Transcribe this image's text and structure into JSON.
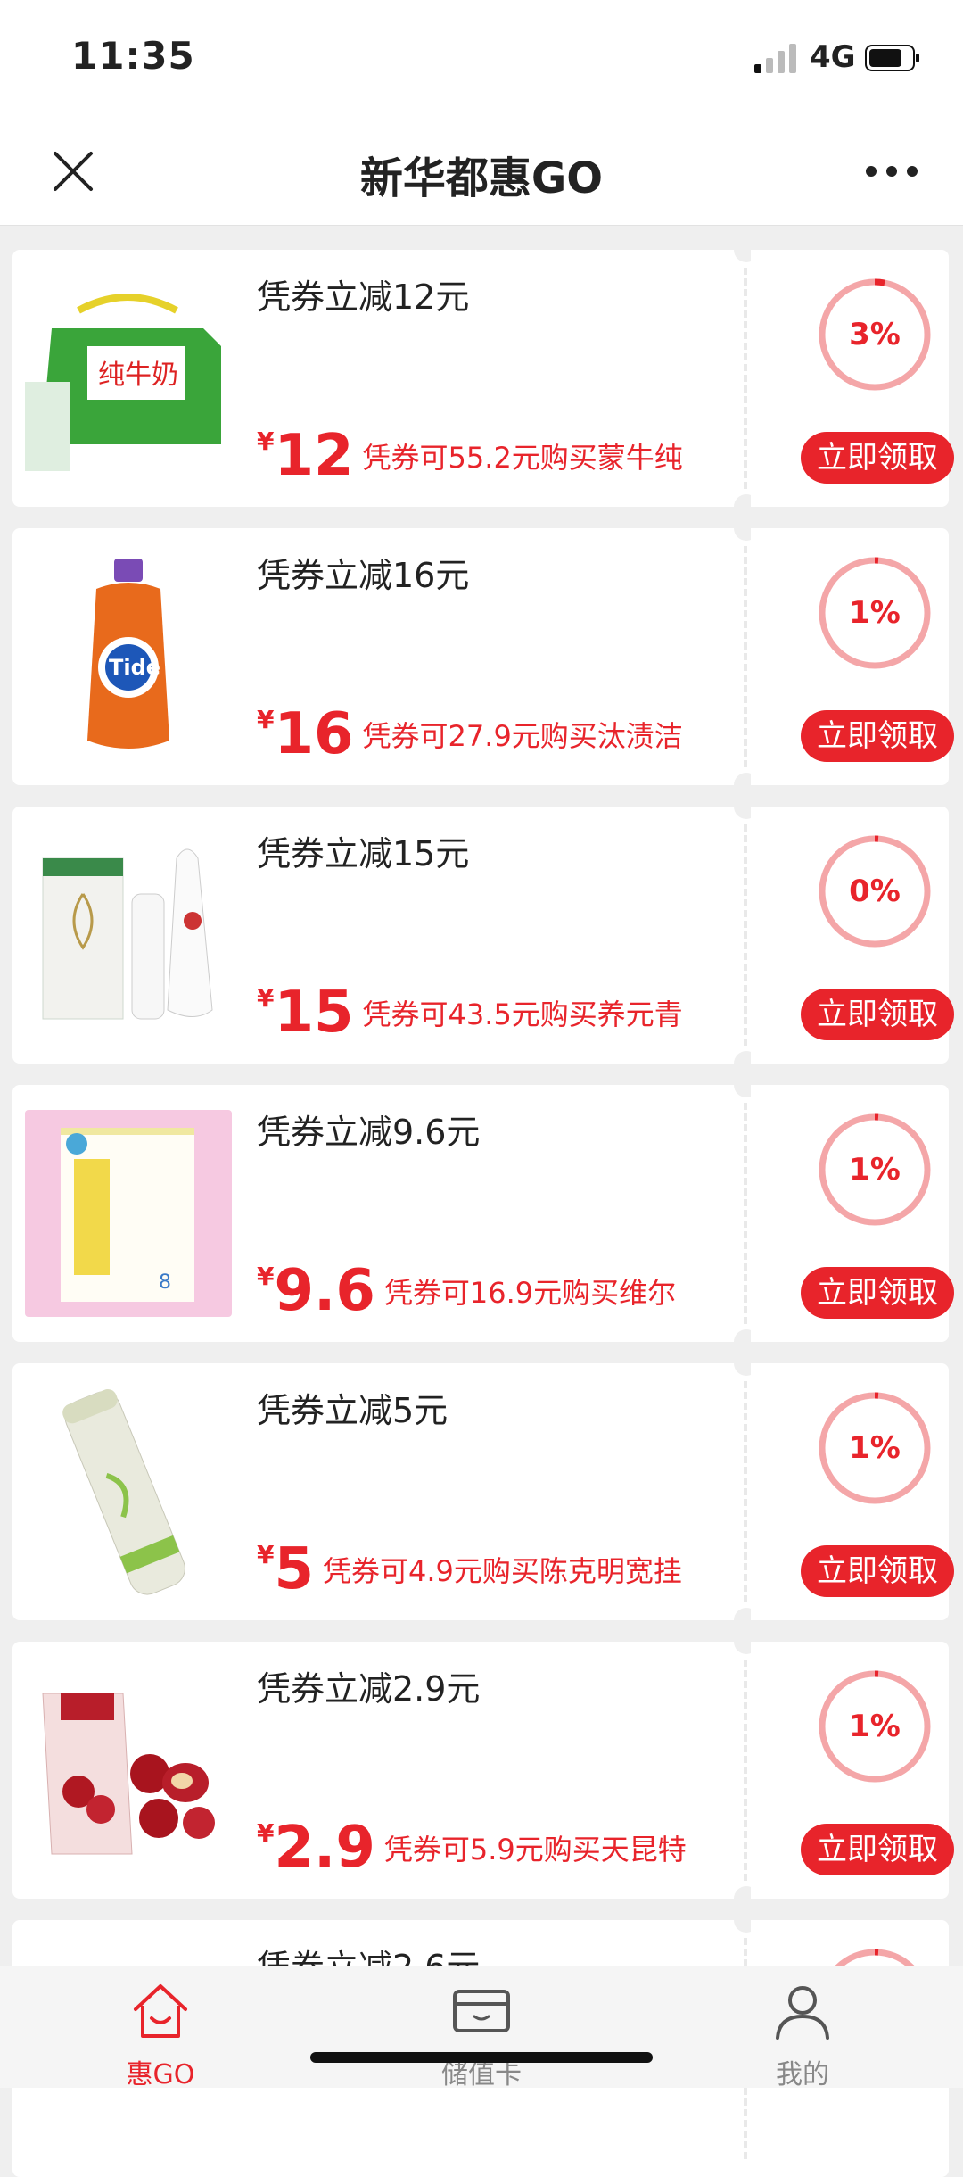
{
  "status_bar": {
    "time": "11:35",
    "network": "4G"
  },
  "nav": {
    "title": "新华都惠GO"
  },
  "coupons": [
    {
      "title": "凭券立减12元",
      "amount": "12",
      "desc": "凭券可55.2元购买蒙牛纯",
      "percent": "3%",
      "progress": 0.03,
      "button": "立即领取",
      "image": "milk-box"
    },
    {
      "title": "凭券立减16元",
      "amount": "16",
      "desc": "凭券可27.9元购买汰渍洁",
      "percent": "1%",
      "progress": 0.01,
      "button": "立即领取",
      "image": "detergent-bottle"
    },
    {
      "title": "凭券立减15元",
      "amount": "15",
      "desc": "凭券可43.5元购买养元青",
      "percent": "0%",
      "progress": 0.0,
      "button": "立即领取",
      "image": "hair-care-set"
    },
    {
      "title": "凭券立减9.6元",
      "amount": "9.6",
      "desc": "凭券可16.9元购买维尔",
      "percent": "1%",
      "progress": 0.01,
      "button": "立即领取",
      "image": "tissue-pack"
    },
    {
      "title": "凭券立减5元",
      "amount": "5",
      "desc": "凭券可4.9元购买陈克明宽挂",
      "percent": "1%",
      "progress": 0.01,
      "button": "立即领取",
      "image": "noodle-roll"
    },
    {
      "title": "凭券立减2.9元",
      "amount": "2.9",
      "desc": "凭券可5.9元购买天昆特",
      "percent": "1%",
      "progress": 0.01,
      "button": "立即领取",
      "image": "red-dates"
    },
    {
      "title": "凭券立减2.6元",
      "amount": "",
      "desc": "",
      "percent": "",
      "progress": 0.01,
      "button": "",
      "image": "partial-item"
    }
  ],
  "currency_symbol": "¥",
  "tabs": [
    {
      "label": "惠GO",
      "icon": "home-icon"
    },
    {
      "label": "储值卡",
      "icon": "card-icon"
    },
    {
      "label": "我的",
      "icon": "user-icon"
    }
  ],
  "colors": {
    "accent": "#e8242b",
    "ring": "#f4a6a8"
  }
}
